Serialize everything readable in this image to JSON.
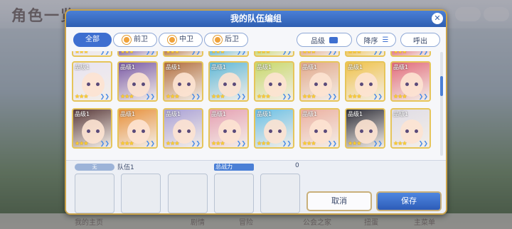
{
  "background": {
    "title": "角色一览",
    "nav": [
      "我的主页",
      "剧情",
      "冒险",
      "公会之家",
      "扭蛋",
      "主菜单"
    ]
  },
  "modal": {
    "title": "我的队伍编组",
    "close_icon": "close-icon",
    "filters": {
      "tabs": [
        {
          "label": "全部",
          "active": true
        },
        {
          "label": "前卫",
          "active": false
        },
        {
          "label": "中卫",
          "active": false
        },
        {
          "label": "后卫",
          "active": false
        }
      ],
      "sort_key": "品级",
      "sort_order": "降序",
      "call_out": "呼出"
    },
    "card_level_label": "品级1",
    "row1": [
      {
        "level": "品级1",
        "stars": "★★★",
        "color": "#e8e4f2"
      },
      {
        "level": "品级1",
        "stars": "★★★",
        "color": "#7a5aa6"
      },
      {
        "level": "品级1",
        "stars": "★★★",
        "color": "#b26e3e"
      },
      {
        "level": "品级1",
        "stars": "★★★",
        "color": "#5fb8d8"
      },
      {
        "level": "品级1",
        "stars": "★★★",
        "color": "#c8d86a"
      },
      {
        "level": "品级1",
        "stars": "★★★",
        "color": "#e2a88a"
      },
      {
        "level": "品级1",
        "stars": "★★★",
        "color": "#f0c24a"
      },
      {
        "level": "品级1",
        "stars": "★★★",
        "color": "#e26a7a"
      }
    ],
    "row2": [
      {
        "level": "品级1",
        "stars": "★★★",
        "color": "#5a3a3a"
      },
      {
        "level": "品级1",
        "stars": "★★★",
        "color": "#e8903a"
      },
      {
        "level": "品级1",
        "stars": "★★★",
        "color": "#a9a0d6"
      },
      {
        "level": "品级1",
        "stars": "★★★",
        "color": "#e6a0b2"
      },
      {
        "level": "品级1",
        "stars": "★★★",
        "color": "#6ac0e6"
      },
      {
        "level": "品级1",
        "stars": "★★★",
        "color": "#ecb0a0"
      },
      {
        "level": "品级1",
        "stars": "★★★",
        "color": "#2e2e38"
      },
      {
        "level": "品级1",
        "stars": "★★★",
        "color": "#e0dde6"
      }
    ],
    "team": {
      "badge": "无",
      "name": "队伍1",
      "power_label": "总战力",
      "power_value": "0",
      "cancel": "取消",
      "save": "保存"
    }
  }
}
